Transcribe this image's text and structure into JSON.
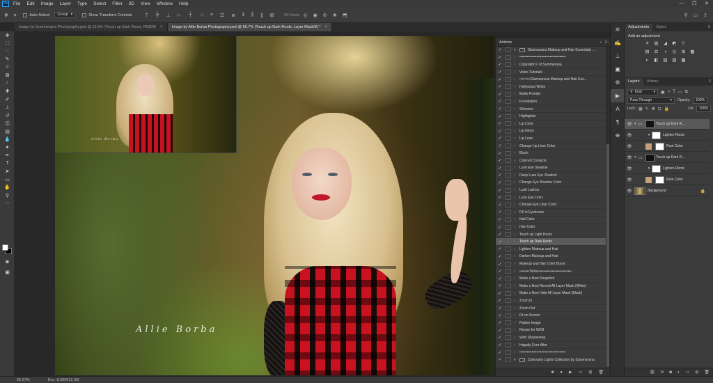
{
  "app": {
    "logo": "Ps"
  },
  "menu": [
    "File",
    "Edit",
    "Image",
    "Layer",
    "Type",
    "Select",
    "Filter",
    "3D",
    "View",
    "Window",
    "Help"
  ],
  "options_bar": {
    "auto_select_label": "Auto-Select:",
    "auto_select_value": "Group",
    "show_transform_label": "Show Transform Controls",
    "mode_3d_label": "3D Mode:"
  },
  "tabs": [
    {
      "label": "Image by Summerana Photography.psd @ 12.5% (Touch up Dark Roots, RGB/8)",
      "close": "×"
    },
    {
      "label": "Image by Allie Borba Photography.psd @ 66.7% (Touch up Dark Roots, Layer Mask/8) *",
      "close": "×"
    }
  ],
  "photo": {
    "signature": "Allie Borba"
  },
  "status": {
    "zoom": "66.67%",
    "doc": "Doc: 8.09M/12.3M"
  },
  "actions": {
    "title": "Actions",
    "items": [
      {
        "label": "Glamourana Makeup and Hair Essentials ...",
        "kind": "set",
        "check": "✓"
      },
      {
        "label": "••••••••••••••••••••••••••••••••••••••",
        "kind": "action",
        "check": "✓"
      },
      {
        "label": "Copyright © of Summerana",
        "kind": "action",
        "check": "✓"
      },
      {
        "label": "Video Tutorials",
        "kind": "action",
        "check": "✓"
      },
      {
        "label": "•••••••••Glamourana Makeup and Hair Ess...",
        "kind": "action",
        "check": "✓"
      },
      {
        "label": "Hollywood White",
        "kind": "action",
        "check": "✓"
      },
      {
        "label": "Matte Powder",
        "kind": "action",
        "check": "✓"
      },
      {
        "label": "Foundation",
        "kind": "action",
        "check": "✓"
      },
      {
        "label": "Shimmer",
        "kind": "action",
        "check": "✓"
      },
      {
        "label": "Highlighter",
        "kind": "action",
        "check": "✓"
      },
      {
        "label": "Lip Color",
        "kind": "action",
        "check": "✓"
      },
      {
        "label": "Lip Gloss",
        "kind": "action",
        "check": "✓"
      },
      {
        "label": "Lip Liner",
        "kind": "action",
        "check": "✓"
      },
      {
        "label": "Change Lip Liner Color",
        "kind": "action",
        "check": "✓"
      },
      {
        "label": "Blush",
        "kind": "action",
        "check": "✓"
      },
      {
        "label": "Colored Contacts",
        "kind": "action",
        "check": "✓"
      },
      {
        "label": "Luxe Eye Shadow",
        "kind": "action",
        "check": "✓"
      },
      {
        "label": "Deep Luxe Eye Shadow",
        "kind": "action",
        "check": "✓"
      },
      {
        "label": "Change Eye Shadow Color",
        "kind": "action",
        "check": "✓"
      },
      {
        "label": "Lush Lashes",
        "kind": "action",
        "check": "✓"
      },
      {
        "label": "Luxe Eye Liner",
        "kind": "action",
        "check": "✓"
      },
      {
        "label": "Change Eye Liner Color",
        "kind": "action",
        "check": "✓"
      },
      {
        "label": "Fill in Eyebrows",
        "kind": "action",
        "check": "✓"
      },
      {
        "label": "Nail Color",
        "kind": "action",
        "check": "✓"
      },
      {
        "label": "Hair Color",
        "kind": "action",
        "check": "✓"
      },
      {
        "label": "Touch up Light Roots",
        "kind": "action",
        "check": "✓"
      },
      {
        "label": "Touch up Dark Roots",
        "kind": "action",
        "check": "✓",
        "selected": true
      },
      {
        "label": "Lighten Makeup and Hair",
        "kind": "action",
        "check": "✓"
      },
      {
        "label": "Darken Makeup and Hair",
        "kind": "action",
        "check": "✓"
      },
      {
        "label": "Makeup and Hair Color Boost",
        "kind": "action",
        "check": "✓"
      },
      {
        "label": "••••••••Tools••••••••••••••••••••••••••••",
        "kind": "action",
        "check": "✓"
      },
      {
        "label": "Make a New Snapshot",
        "kind": "action",
        "check": "✓"
      },
      {
        "label": "Make a New Reveal All Layer Mask (White)",
        "kind": "action",
        "check": "✓"
      },
      {
        "label": "Make a New Hide All Layer Mask (Black)",
        "kind": "action",
        "check": "✓"
      },
      {
        "label": "Zoom In",
        "kind": "action",
        "check": "✓"
      },
      {
        "label": "Zoom Out",
        "kind": "action",
        "check": "✓"
      },
      {
        "label": "Fit on Screen",
        "kind": "action",
        "check": "✓"
      },
      {
        "label": "Flatten Image",
        "kind": "action",
        "check": "✓"
      },
      {
        "label": "Resize for WEB",
        "kind": "action",
        "check": "✓"
      },
      {
        "label": "Web Sharpening",
        "kind": "action",
        "check": "✓"
      },
      {
        "label": "Happily Ever After",
        "kind": "action",
        "check": "✓"
      },
      {
        "label": "••••••••••••••••••••••••••••••••••••••",
        "kind": "action",
        "check": "✓"
      },
      {
        "label": "Colorosity Lights Collection by Summerana",
        "kind": "set",
        "check": "✓"
      }
    ]
  },
  "adjustments": {
    "tab_active": "Adjustments",
    "tab_other": "Styles",
    "title": "Add an adjustment",
    "row1": [
      "☀",
      "▥",
      "◢",
      "◩",
      "▽"
    ],
    "row2": [
      "▤",
      "⚖",
      "◑",
      "◎",
      "⊞",
      "▦"
    ],
    "row3": [
      "◐",
      "◧",
      "▨",
      "▧",
      "▩"
    ]
  },
  "layers": {
    "tab_active": "Layers",
    "tab_other": "History",
    "kind_label": "Kind",
    "blend_mode": "Pass Through",
    "opacity_label": "Opacity:",
    "opacity_value": "100%",
    "lock_label": "Lock:",
    "fill_label": "Fill:",
    "fill_value": "100%",
    "list": [
      {
        "name": "Touch up Dark R...",
        "type": "group",
        "selected": true
      },
      {
        "name": "Lighten Roots",
        "type": "adjustment"
      },
      {
        "name": "Root Color",
        "type": "fill"
      },
      {
        "name": "Touch up Dark R...",
        "type": "group"
      },
      {
        "name": "Lighten Roots",
        "type": "adjustment"
      },
      {
        "name": "Root Color",
        "type": "fill"
      },
      {
        "name": "Background",
        "type": "background"
      }
    ]
  },
  "colors": {
    "accent": "#31a8ff",
    "selected_row": "#5b5b5b",
    "panel": "#3b3b3b"
  }
}
